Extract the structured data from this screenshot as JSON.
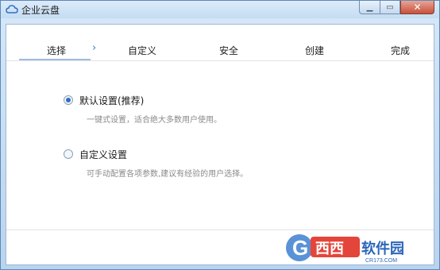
{
  "window": {
    "title": "企业云盘",
    "icon": "cloud-icon",
    "buttons": {
      "minimize": "minimize-icon",
      "maximize": "maximize-icon",
      "close": "close-icon"
    }
  },
  "steps": {
    "items": [
      "选择",
      "自定义",
      "安全",
      "创建",
      "完成"
    ],
    "active_index": 0,
    "separator_icon": "chevron-right-icon"
  },
  "options": [
    {
      "label": "默认设置(推荐)",
      "desc": "一键式设置，适合绝大多数用户使用。",
      "checked": true
    },
    {
      "label": "自定义设置",
      "desc": "可手动配置各项参数,建议有经验的用户选择。",
      "checked": false
    }
  ],
  "watermark": {
    "main": "西西软件园",
    "sub": "CR173.COM"
  },
  "colors": {
    "accent": "#2f6fc4",
    "titlebar": "#c4dcf2",
    "close": "#c7503b"
  }
}
